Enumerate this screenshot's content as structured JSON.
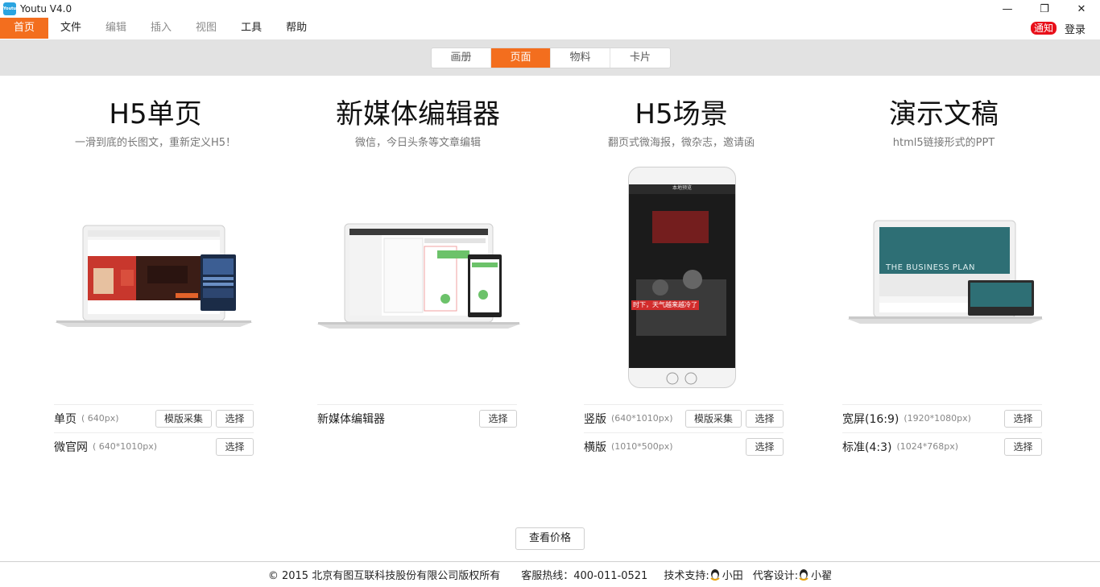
{
  "window": {
    "logo_text": "Youtu",
    "title": "Youtu V4.0",
    "minimize": "—",
    "restore": "❐",
    "close": "✕"
  },
  "menu": {
    "items": [
      {
        "label": "首页"
      },
      {
        "label": "文件"
      },
      {
        "label": "编辑"
      },
      {
        "label": "插入"
      },
      {
        "label": "视图"
      },
      {
        "label": "工具"
      },
      {
        "label": "帮助"
      }
    ],
    "notice": "通知",
    "login": "登录"
  },
  "tabs": [
    {
      "label": "画册"
    },
    {
      "label": "页面"
    },
    {
      "label": "物料"
    },
    {
      "label": "卡片"
    }
  ],
  "products": [
    {
      "title": "H5单页",
      "subtitle": "一滑到底的长图文，重新定义H5！",
      "options": [
        {
          "name": "单页",
          "size": "( 640px)",
          "template_btn": "模版采集",
          "select_btn": "选择"
        },
        {
          "name": "微官网",
          "size": "( 640*1010px)",
          "select_btn": "选择"
        }
      ]
    },
    {
      "title": "新媒体编辑器",
      "subtitle": "微信，今日头条等文章编辑",
      "options": [
        {
          "name": "新媒体编辑器",
          "select_btn": "选择"
        }
      ]
    },
    {
      "title": "H5场景",
      "subtitle": "翻页式微海报，微杂志，邀请函",
      "phone_header": "本地预览",
      "phone_caption": "时下，天气越来越冷了",
      "options": [
        {
          "name": "竖版",
          "size": "(640*1010px)",
          "template_btn": "模版采集",
          "select_btn": "选择"
        },
        {
          "name": "横版",
          "size": "(1010*500px)",
          "select_btn": "选择"
        }
      ]
    },
    {
      "title": "演示文稿",
      "subtitle": "html5链接形式的PPT",
      "slide_text": "THE BUSINESS PLAN",
      "options": [
        {
          "name": "宽屏(16:9)",
          "size": "(1920*1080px)",
          "select_btn": "选择"
        },
        {
          "name": "标准(4:3)",
          "size": "(1024*768px)",
          "select_btn": "选择"
        }
      ]
    }
  ],
  "price_button": "查看价格",
  "footer": {
    "copyright": "© 2015 北京有图互联科技股份有限公司版权所有",
    "hotline": "客服热线：400-011-0521",
    "support_label": "技术支持:",
    "support_name": "小田",
    "design_label": "代客设计:",
    "design_name": "小翟"
  },
  "colors": {
    "accent": "#f36e1e",
    "notice": "#e8101a",
    "tabs_bg": "#e2e2e2"
  }
}
